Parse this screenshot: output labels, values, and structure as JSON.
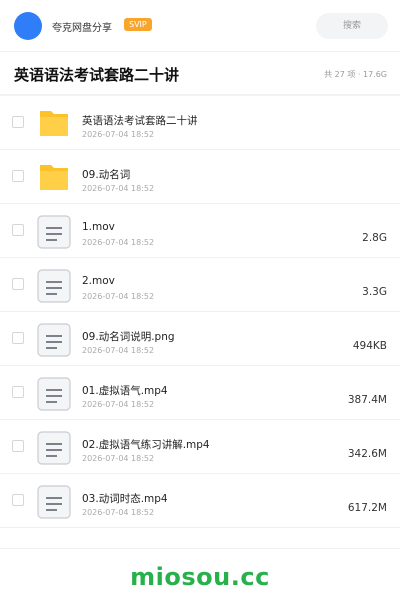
{
  "header": {
    "app_name": "夸克网盘分享",
    "vip_badge": "SVIP",
    "search_placeholder": "搜索",
    "avatar_color": "#2f7ef7"
  },
  "folder": {
    "title": "英语语法考试套路二十讲",
    "meta": "共 27 项 · 17.6G"
  },
  "files": [
    {
      "type": "folder",
      "icon": "folder-icon",
      "name": "英语语法考试套路二十讲",
      "date": "2026-07-04 18:52",
      "size": ""
    },
    {
      "type": "folder",
      "icon": "folder-icon",
      "name": "09.动名词",
      "date": "2026-07-04 18:52",
      "size": ""
    },
    {
      "type": "file",
      "icon": "document-icon",
      "name": "1.mov",
      "date": "2026-07-04 18:52",
      "size": "2.8G"
    },
    {
      "type": "file",
      "icon": "document-icon",
      "name": "2.mov",
      "date": "2026-07-04 18:52",
      "size": "3.3G"
    },
    {
      "type": "file",
      "icon": "document-icon",
      "name": "09.动名词说明.png",
      "date": "2026-07-04 18:52",
      "size": "494KB"
    },
    {
      "type": "file",
      "icon": "document-icon",
      "name": "01.虚拟语气.mp4",
      "date": "2026-07-04 18:52",
      "size": "387.4M"
    },
    {
      "type": "file",
      "icon": "document-icon",
      "name": "02.虚拟语气练习讲解.mp4",
      "date": "2026-07-04 18:52",
      "size": "342.6M"
    },
    {
      "type": "file",
      "icon": "document-icon",
      "name": "03.动词时态.mp4",
      "date": "2026-07-04 18:52",
      "size": "617.2M"
    }
  ],
  "watermark": "miosou.cc",
  "colors": {
    "folder": "#fdc12a",
    "accent_green": "#27b14b",
    "vip": "#f7a52b"
  }
}
